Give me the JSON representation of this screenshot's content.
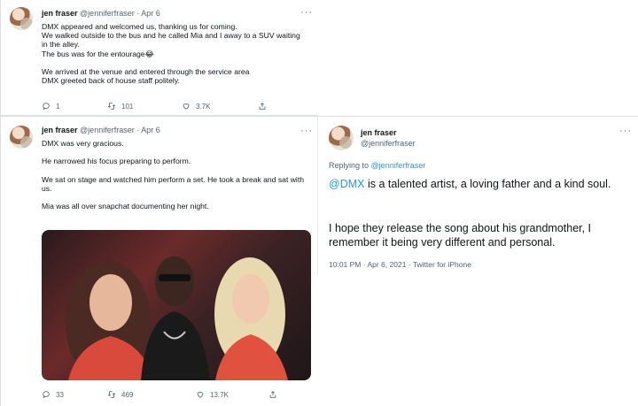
{
  "tweet1": {
    "name": "jen fraser",
    "handle": "@jenniferfraser",
    "dot": "·",
    "date": "Apr 6",
    "more": "···",
    "text": "DMX appeared and welcomed us, thanking us for coming.\nWe walked outside to the bus and he called Mia and I away to a SUV waiting in the alley.\nThe bus was for the entourage😂\n\nWe arrived at the venue and entered through the service area\nDMX greeted back of house staff politely.",
    "replies": "1",
    "retweets": "101",
    "likes": "3.7K"
  },
  "tweet2": {
    "name": "jen fraser",
    "handle": "@jenniferfraser",
    "dot": "·",
    "date": "Apr 6",
    "more": "···",
    "text": "DMX was very gracious.\n\nHe narrowed his focus preparing to perform.\n\nWe sat on stage and watched him perform a set. He took a break and sat with us.\n\nMia was all over snapchat documenting her night.",
    "replies": "33",
    "retweets": "469",
    "likes": "13.7K"
  },
  "tweet3": {
    "name": "jen fraser",
    "handle": "@jenniferfraser",
    "reply_prefix": "Replying to",
    "reply_to": "@jenniferfraser",
    "mention": "@DMX",
    "text_main": " is a talented artist, a loving father and a kind soul.",
    "text_second": "I hope they release the song about his grandmother, I remember it being very different and personal.",
    "timestamp": "10:01 PM · Apr 6, 2021 · Twitter for iPhone"
  },
  "icons": {
    "reply": "reply-icon",
    "retweet": "retweet-icon",
    "like": "heart-icon",
    "share": "share-icon",
    "more": "more-icon"
  },
  "colors": {
    "link": "#1d9bf0",
    "muted": "#536471",
    "text": "#0f1419",
    "border": "#dcdfe2"
  }
}
